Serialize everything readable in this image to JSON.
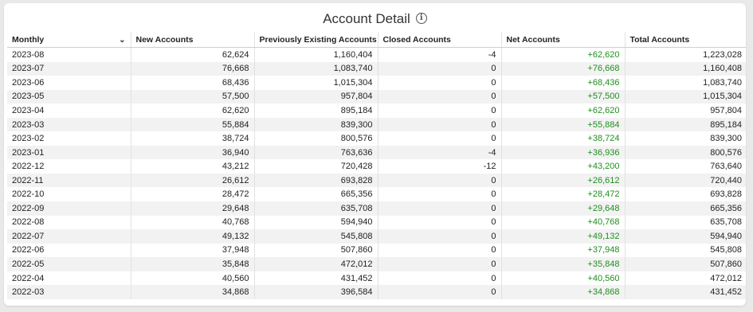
{
  "header": {
    "title": "Account Detail",
    "info_icon": "info-icon"
  },
  "columns": [
    "Monthly",
    "New Accounts",
    "Previously Existing Accounts",
    "Closed Accounts",
    "Net Accounts",
    "Total Accounts"
  ],
  "sort_icon": "chevron-down-icon",
  "colors": {
    "net_positive": "#1f8f1f",
    "row_stripe": "#f2f2f2"
  },
  "rows": [
    [
      "2023-08",
      "62,624",
      "1,160,404",
      "-4",
      "+62,620",
      "1,223,028"
    ],
    [
      "2023-07",
      "76,668",
      "1,083,740",
      "0",
      "+76,668",
      "1,160,408"
    ],
    [
      "2023-06",
      "68,436",
      "1,015,304",
      "0",
      "+68,436",
      "1,083,740"
    ],
    [
      "2023-05",
      "57,500",
      "957,804",
      "0",
      "+57,500",
      "1,015,304"
    ],
    [
      "2023-04",
      "62,620",
      "895,184",
      "0",
      "+62,620",
      "957,804"
    ],
    [
      "2023-03",
      "55,884",
      "839,300",
      "0",
      "+55,884",
      "895,184"
    ],
    [
      "2023-02",
      "38,724",
      "800,576",
      "0",
      "+38,724",
      "839,300"
    ],
    [
      "2023-01",
      "36,940",
      "763,636",
      "-4",
      "+36,936",
      "800,576"
    ],
    [
      "2022-12",
      "43,212",
      "720,428",
      "-12",
      "+43,200",
      "763,640"
    ],
    [
      "2022-11",
      "26,612",
      "693,828",
      "0",
      "+26,612",
      "720,440"
    ],
    [
      "2022-10",
      "28,472",
      "665,356",
      "0",
      "+28,472",
      "693,828"
    ],
    [
      "2022-09",
      "29,648",
      "635,708",
      "0",
      "+29,648",
      "665,356"
    ],
    [
      "2022-08",
      "40,768",
      "594,940",
      "0",
      "+40,768",
      "635,708"
    ],
    [
      "2022-07",
      "49,132",
      "545,808",
      "0",
      "+49,132",
      "594,940"
    ],
    [
      "2022-06",
      "37,948",
      "507,860",
      "0",
      "+37,948",
      "545,808"
    ],
    [
      "2022-05",
      "35,848",
      "472,012",
      "0",
      "+35,848",
      "507,860"
    ],
    [
      "2022-04",
      "40,560",
      "431,452",
      "0",
      "+40,560",
      "472,012"
    ],
    [
      "2022-03",
      "34,868",
      "396,584",
      "0",
      "+34,868",
      "431,452"
    ]
  ]
}
